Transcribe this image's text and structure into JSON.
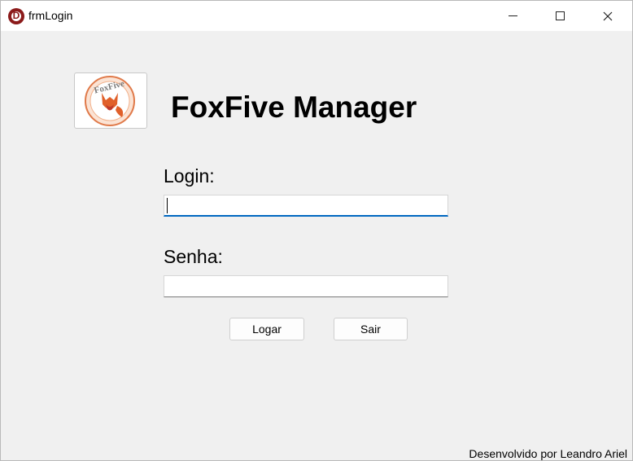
{
  "window": {
    "title": "frmLogin",
    "app_icon_letter": "D",
    "close_glyph": "✕"
  },
  "main": {
    "heading": "FoxFive Manager",
    "logo_text": "FoxFive",
    "login_label": "Login:",
    "login_value": "",
    "senha_label": "Senha:",
    "senha_value": "",
    "logar_button": "Logar",
    "sair_button": "Sair",
    "footer": "Desenvolvido por Leandro Ariel"
  },
  "colors": {
    "accent": "#0067c0",
    "background": "#f0f0f0",
    "logo_orange": "#e0602a",
    "logo_red": "#c0392b"
  }
}
